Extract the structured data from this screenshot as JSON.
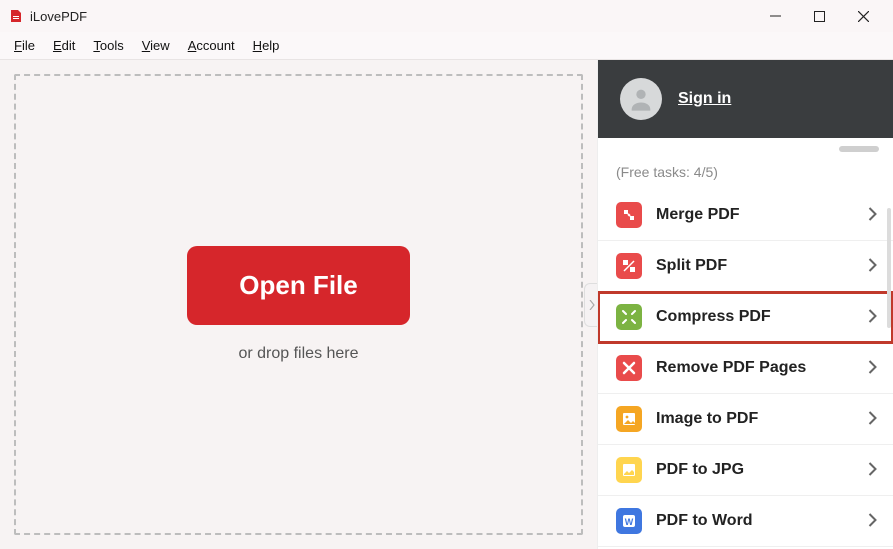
{
  "window": {
    "title": "iLovePDF"
  },
  "menu": {
    "items": [
      "File",
      "Edit",
      "Tools",
      "View",
      "Account",
      "Help"
    ]
  },
  "dropzone": {
    "button": "Open File",
    "hint": "or drop files here"
  },
  "sidebar": {
    "signin": "Sign in",
    "free_tasks": "(Free tasks: 4/5)",
    "tools": [
      {
        "label": "Merge PDF",
        "icon": "merge-icon",
        "color": "ic-red",
        "highlight": false
      },
      {
        "label": "Split PDF",
        "icon": "split-icon",
        "color": "ic-red",
        "highlight": false
      },
      {
        "label": "Compress PDF",
        "icon": "compress-icon",
        "color": "ic-green",
        "highlight": true
      },
      {
        "label": "Remove PDF Pages",
        "icon": "remove-icon",
        "color": "ic-red",
        "highlight": false
      },
      {
        "label": "Image to PDF",
        "icon": "image-icon",
        "color": "ic-orange",
        "highlight": false
      },
      {
        "label": "PDF to JPG",
        "icon": "pdf2jpg-icon",
        "color": "ic-yellow",
        "highlight": false
      },
      {
        "label": "PDF to Word",
        "icon": "pdf2word-icon",
        "color": "ic-blue",
        "highlight": false
      }
    ]
  }
}
